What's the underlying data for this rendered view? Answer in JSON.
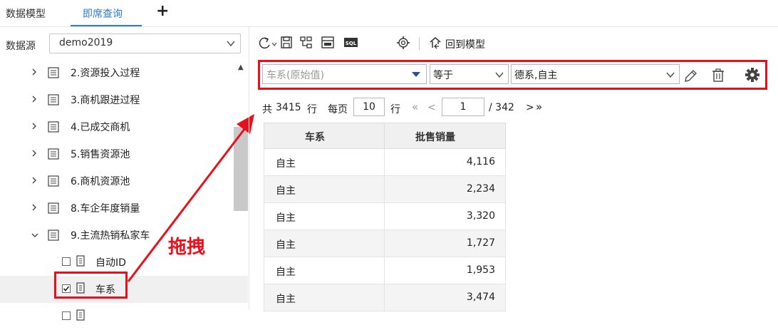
{
  "tabs": {
    "model": "数据模型",
    "query": "即席查询",
    "add": "+"
  },
  "datasource": {
    "label": "数据源",
    "value": "demo2019"
  },
  "tree": {
    "tables": [
      {
        "label": "2.资源投入过程",
        "expanded": false
      },
      {
        "label": "3.商机跟进过程",
        "expanded": false
      },
      {
        "label": "4.已成交商机",
        "expanded": false
      },
      {
        "label": "5.销售资源池",
        "expanded": false
      },
      {
        "label": "6.商机资源池",
        "expanded": false
      },
      {
        "label": "8.车企年度销量",
        "expanded": false
      },
      {
        "label": "9.主流热销私家车",
        "expanded": true
      }
    ],
    "fields": [
      {
        "label": "自动ID",
        "checked": false
      },
      {
        "label": "车系",
        "checked": true
      },
      {
        "label": "",
        "checked": false
      }
    ]
  },
  "annotation": {
    "drag_text": "拖拽",
    "color": "#e8101a"
  },
  "toolbar": {
    "back_to_model": "回到模型",
    "sql": "SQL"
  },
  "filter": {
    "field": "车系(原始值)",
    "operator": "等于",
    "value": "德系,自主"
  },
  "pager": {
    "total_prefix": "共",
    "total": "3415",
    "total_suffix": "行",
    "per_page_label": "每页",
    "per_page": "10",
    "rows_label": "行",
    "first": "«",
    "prev": "<",
    "page": "1",
    "page_total": "/ 342",
    "next": ">",
    "last": "»"
  },
  "table": {
    "columns": [
      "车系",
      "批售销量"
    ],
    "rows": [
      [
        "自主",
        "4,116"
      ],
      [
        "自主",
        "2,234"
      ],
      [
        "自主",
        "3,320"
      ],
      [
        "自主",
        "1,727"
      ],
      [
        "自主",
        "1,953"
      ],
      [
        "自主",
        "3,474"
      ]
    ]
  },
  "colors": {
    "accent": "#2d7cd6",
    "annotation": "#e8101a",
    "header_bg": "#f0f0f0"
  }
}
